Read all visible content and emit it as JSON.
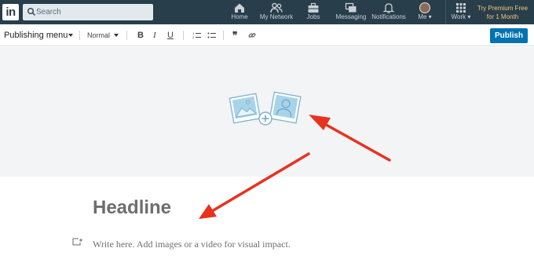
{
  "nav": {
    "logo": "in",
    "search_placeholder": "Search",
    "items": [
      {
        "label": "Home",
        "icon": "home-icon"
      },
      {
        "label": "My Network",
        "icon": "network-icon"
      },
      {
        "label": "Jobs",
        "icon": "briefcase-icon"
      },
      {
        "label": "Messaging",
        "icon": "messaging-icon"
      },
      {
        "label": "Notifications",
        "icon": "bell-icon"
      },
      {
        "label": "Me",
        "icon": "avatar"
      },
      {
        "label": "Work",
        "icon": "grid-icon"
      }
    ],
    "premium_line1": "Try Premium Free",
    "premium_line2": "for 1 Month"
  },
  "toolbar": {
    "publishing_menu": "Publishing menu",
    "style_select": "Normal",
    "bold": "B",
    "italic": "I",
    "underline": "U",
    "quote": "❞",
    "publish_label": "Publish"
  },
  "editor": {
    "headline": "Headline",
    "body_placeholder": "Write here. Add images or a video for visual impact."
  },
  "colors": {
    "nav_bg": "#283e4a",
    "accent": "#0073b1",
    "arrow": "#e8321e",
    "cover_bg": "#f2f4f6"
  }
}
